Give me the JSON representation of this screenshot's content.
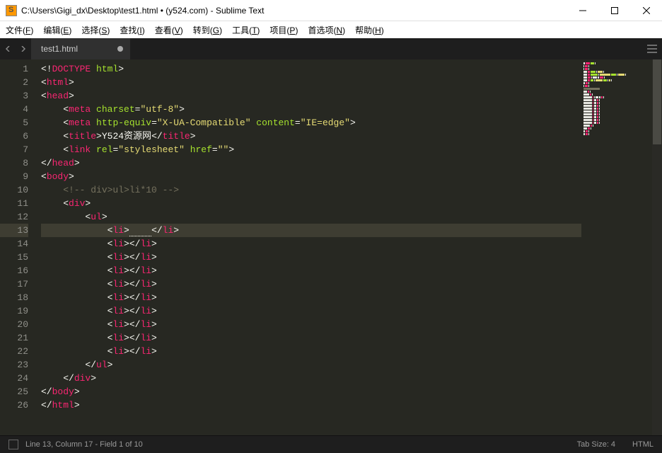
{
  "titlebar": {
    "title": "C:\\Users\\Gigi_dx\\Desktop\\test1.html • (y524.com) - Sublime Text"
  },
  "menu": {
    "items": [
      {
        "label": "文件",
        "key": "F"
      },
      {
        "label": "编辑",
        "key": "E"
      },
      {
        "label": "选择",
        "key": "S"
      },
      {
        "label": "查找",
        "key": "I"
      },
      {
        "label": "查看",
        "key": "V"
      },
      {
        "label": "转到",
        "key": "G"
      },
      {
        "label": "工具",
        "key": "T"
      },
      {
        "label": "项目",
        "key": "P"
      },
      {
        "label": "首选项",
        "key": "N"
      },
      {
        "label": "帮助",
        "key": "H"
      }
    ]
  },
  "tabs": {
    "items": [
      {
        "label": "test1.html",
        "dirty": true
      }
    ]
  },
  "code": {
    "lines": [
      [
        {
          "cls": "p",
          "t": "<!"
        },
        {
          "cls": "t",
          "t": "DOCTYPE"
        },
        {
          "cls": "a",
          "t": " html"
        },
        {
          "cls": "p",
          "t": ">"
        }
      ],
      [
        {
          "cls": "p",
          "t": "<"
        },
        {
          "cls": "t",
          "t": "html"
        },
        {
          "cls": "p",
          "t": ">"
        }
      ],
      [
        {
          "cls": "p",
          "t": "<"
        },
        {
          "cls": "t",
          "t": "head"
        },
        {
          "cls": "p",
          "t": ">"
        }
      ],
      [
        {
          "cls": "p",
          "t": "    <"
        },
        {
          "cls": "t",
          "t": "meta"
        },
        {
          "cls": "a",
          "t": " charset"
        },
        {
          "cls": "p",
          "t": "="
        },
        {
          "cls": "s",
          "t": "\"utf-8\""
        },
        {
          "cls": "p",
          "t": ">"
        }
      ],
      [
        {
          "cls": "p",
          "t": "    <"
        },
        {
          "cls": "t",
          "t": "meta"
        },
        {
          "cls": "a",
          "t": " http-equiv"
        },
        {
          "cls": "p",
          "t": "="
        },
        {
          "cls": "s",
          "t": "\"X-UA-Compatible\""
        },
        {
          "cls": "a",
          "t": " content"
        },
        {
          "cls": "p",
          "t": "="
        },
        {
          "cls": "s",
          "t": "\"IE=edge\""
        },
        {
          "cls": "p",
          "t": ">"
        }
      ],
      [
        {
          "cls": "p",
          "t": "    <"
        },
        {
          "cls": "t",
          "t": "title"
        },
        {
          "cls": "p",
          "t": ">"
        },
        {
          "cls": "p",
          "t": "Y524资源网"
        },
        {
          "cls": "p",
          "t": "</"
        },
        {
          "cls": "t",
          "t": "title"
        },
        {
          "cls": "p",
          "t": ">"
        }
      ],
      [
        {
          "cls": "p",
          "t": "    <"
        },
        {
          "cls": "t",
          "t": "link"
        },
        {
          "cls": "a",
          "t": " rel"
        },
        {
          "cls": "p",
          "t": "="
        },
        {
          "cls": "s",
          "t": "\"stylesheet\""
        },
        {
          "cls": "a",
          "t": " href"
        },
        {
          "cls": "p",
          "t": "="
        },
        {
          "cls": "s",
          "t": "\"\""
        },
        {
          "cls": "p",
          "t": ">"
        }
      ],
      [
        {
          "cls": "p",
          "t": "</"
        },
        {
          "cls": "t",
          "t": "head"
        },
        {
          "cls": "p",
          "t": ">"
        }
      ],
      [
        {
          "cls": "p",
          "t": "<"
        },
        {
          "cls": "t",
          "t": "body"
        },
        {
          "cls": "p",
          "t": ">"
        }
      ],
      [
        {
          "cls": "c",
          "t": "    <!-- div>ul>li*10 -->"
        }
      ],
      [
        {
          "cls": "p",
          "t": "    <"
        },
        {
          "cls": "t",
          "t": "div"
        },
        {
          "cls": "p",
          "t": ">"
        }
      ],
      [
        {
          "cls": "p",
          "t": "        <"
        },
        {
          "cls": "t",
          "t": "ul"
        },
        {
          "cls": "p",
          "t": ">"
        }
      ],
      [
        {
          "cls": "p",
          "t": "            <"
        },
        {
          "cls": "t",
          "t": "li"
        },
        {
          "cls": "p",
          "t": ">"
        },
        {
          "cls": "p cursor-mark",
          "t": "    "
        },
        {
          "cls": "p",
          "t": "</"
        },
        {
          "cls": "t",
          "t": "li"
        },
        {
          "cls": "p",
          "t": ">"
        }
      ],
      [
        {
          "cls": "p",
          "t": "            <"
        },
        {
          "cls": "t",
          "t": "li"
        },
        {
          "cls": "p",
          "t": "></"
        },
        {
          "cls": "t",
          "t": "li"
        },
        {
          "cls": "p",
          "t": ">"
        }
      ],
      [
        {
          "cls": "p",
          "t": "            <"
        },
        {
          "cls": "t",
          "t": "li"
        },
        {
          "cls": "p",
          "t": "></"
        },
        {
          "cls": "t",
          "t": "li"
        },
        {
          "cls": "p",
          "t": ">"
        }
      ],
      [
        {
          "cls": "p",
          "t": "            <"
        },
        {
          "cls": "t",
          "t": "li"
        },
        {
          "cls": "p",
          "t": "></"
        },
        {
          "cls": "t",
          "t": "li"
        },
        {
          "cls": "p",
          "t": ">"
        }
      ],
      [
        {
          "cls": "p",
          "t": "            <"
        },
        {
          "cls": "t",
          "t": "li"
        },
        {
          "cls": "p",
          "t": "></"
        },
        {
          "cls": "t",
          "t": "li"
        },
        {
          "cls": "p",
          "t": ">"
        }
      ],
      [
        {
          "cls": "p",
          "t": "            <"
        },
        {
          "cls": "t",
          "t": "li"
        },
        {
          "cls": "p",
          "t": "></"
        },
        {
          "cls": "t",
          "t": "li"
        },
        {
          "cls": "p",
          "t": ">"
        }
      ],
      [
        {
          "cls": "p",
          "t": "            <"
        },
        {
          "cls": "t",
          "t": "li"
        },
        {
          "cls": "p",
          "t": "></"
        },
        {
          "cls": "t",
          "t": "li"
        },
        {
          "cls": "p",
          "t": ">"
        }
      ],
      [
        {
          "cls": "p",
          "t": "            <"
        },
        {
          "cls": "t",
          "t": "li"
        },
        {
          "cls": "p",
          "t": "></"
        },
        {
          "cls": "t",
          "t": "li"
        },
        {
          "cls": "p",
          "t": ">"
        }
      ],
      [
        {
          "cls": "p",
          "t": "            <"
        },
        {
          "cls": "t",
          "t": "li"
        },
        {
          "cls": "p",
          "t": "></"
        },
        {
          "cls": "t",
          "t": "li"
        },
        {
          "cls": "p",
          "t": ">"
        }
      ],
      [
        {
          "cls": "p",
          "t": "            <"
        },
        {
          "cls": "t",
          "t": "li"
        },
        {
          "cls": "p",
          "t": "></"
        },
        {
          "cls": "t",
          "t": "li"
        },
        {
          "cls": "p",
          "t": ">"
        }
      ],
      [
        {
          "cls": "p",
          "t": "        </"
        },
        {
          "cls": "t",
          "t": "ul"
        },
        {
          "cls": "p",
          "t": ">"
        }
      ],
      [
        {
          "cls": "p",
          "t": "    </"
        },
        {
          "cls": "t",
          "t": "div"
        },
        {
          "cls": "p",
          "t": ">"
        }
      ],
      [
        {
          "cls": "p",
          "t": "</"
        },
        {
          "cls": "t",
          "t": "body"
        },
        {
          "cls": "p",
          "t": ">"
        }
      ],
      [
        {
          "cls": "p",
          "t": "</"
        },
        {
          "cls": "t",
          "t": "html"
        },
        {
          "cls": "p",
          "t": ">"
        }
      ]
    ],
    "highlight_line": 13
  },
  "status": {
    "position": "Line 13, Column 17 - Field 1 of 10",
    "tabsize": "Tab Size: 4",
    "syntax": "HTML"
  }
}
